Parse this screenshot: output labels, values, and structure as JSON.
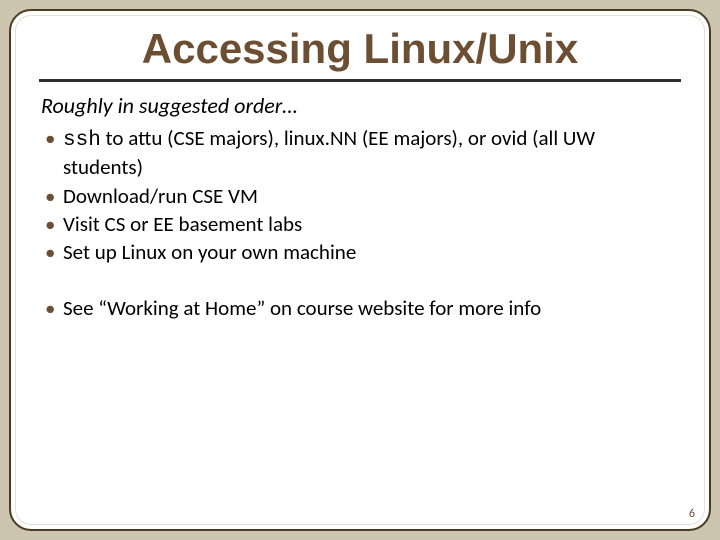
{
  "title": "Accessing Linux/Unix",
  "subtitle": "Roughly in suggested order…",
  "bullets1": {
    "item0": {
      "code": "ssh",
      "rest": " to attu (CSE majors), linux.NN (EE majors), or ovid (all UW students)"
    },
    "item1": "Download/run CSE VM",
    "item2": "Visit CS or EE basement labs",
    "item3": "Set up Linux on your own machine"
  },
  "bullets2": {
    "item0": "See “Working at Home” on course website for more info"
  },
  "page_number": "6"
}
